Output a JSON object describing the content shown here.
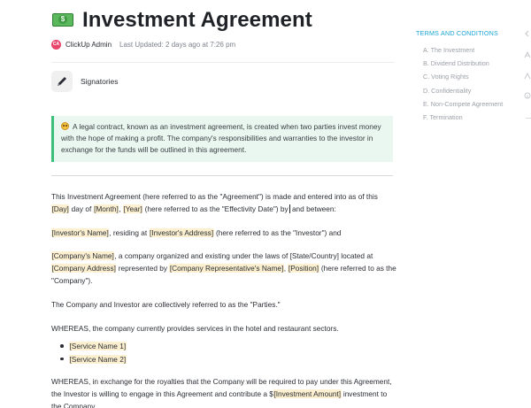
{
  "document": {
    "title": "Investment Agreement",
    "author": "ClickUp Admin",
    "avatar_initials": "CA",
    "last_updated": "Last Updated: 2 days ago at 7:26 pm",
    "signatories_label": "Signatories",
    "callout_text": "A legal contract, known as an investment agreement, is created when two parties invest money with the hope of making a profit. The company's responsibilities and warranties to the investor in exchange for the funds will be outlined in this agreement."
  },
  "body": {
    "p1": {
      "t1": "This Investment Agreement (here referred to as the \"Agreement\") is made and entered into as of this ",
      "day": "[Day]",
      "t2": " day of ",
      "month": "[Month]",
      "t3": ", ",
      "year": "[Year]",
      "t4": " (here referred to as the \"Effectivity Date\") by",
      "t5": " and between:"
    },
    "p2": {
      "investor_name": "[Investor's Name]",
      "t1": ", residing at ",
      "investor_address": "[Investor's Address]",
      "t2": " (here referred to as the \"Investor\") and"
    },
    "p3": {
      "company_name": "[Company's Name]",
      "t1": ", a company organized and existing under the laws of [State/Country] located at ",
      "company_address": "[Company Address]",
      "t2": " represented by ",
      "company_rep": "[Company Representative's Name]",
      "t3": ", ",
      "position": "[Position]",
      "t4": " (here referred to as the \"Company\")."
    },
    "p4": "The Company and Investor are collectively referred to as the \"Parties.\"",
    "p5": "WHEREAS, the company currently provides services in the hotel and restaurant sectors.",
    "services": [
      "[Service Name 1]",
      "[Service Name 2]"
    ],
    "p6": {
      "t1": "WHEREAS, in exchange for the royalties that the Company will be required to pay under this Agreement, the Investor is willing to engage in this Agreement and contribute a $",
      "amount": "[Investment Amount]",
      "t2": " investment to the Company."
    }
  },
  "toc": {
    "heading": "TERMS AND CONDITIONS",
    "items": [
      "A. The Investment",
      "B. Dividend Distribution",
      "C. Voting Rights",
      "D. Confidentiality",
      "E. Non-Compete Agreement",
      "F. Termination"
    ]
  },
  "colors": {
    "accent": "#1aa5d6",
    "callout_bg": "#eaf7f0",
    "callout_border": "#3cbf7a",
    "placeholder_highlight": "#fdf0d0",
    "avatar": "#e8456b"
  },
  "icons": [
    "money-icon",
    "pen-icon",
    "grinning-face-icon"
  ]
}
